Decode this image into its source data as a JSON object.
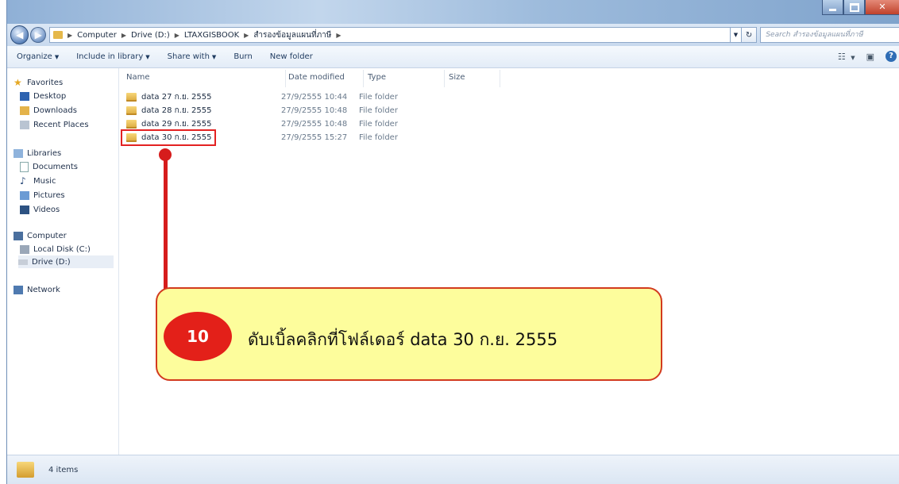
{
  "address": {
    "crumbs": [
      "Computer",
      "Drive (D:)",
      "LTAXGISBOOK",
      "สำรองข้อมูลแผนที่ภาษี"
    ],
    "search_placeholder": "Search สำรองข้อมูลแผนที่ภาษี"
  },
  "toolbar": {
    "organize": "Organize",
    "include": "Include in library",
    "share": "Share with",
    "burn": "Burn",
    "new_folder": "New folder"
  },
  "nav": {
    "favorites": "Favorites",
    "desktop": "Desktop",
    "downloads": "Downloads",
    "recent": "Recent Places",
    "libraries": "Libraries",
    "documents": "Documents",
    "music": "Music",
    "pictures": "Pictures",
    "videos": "Videos",
    "computer": "Computer",
    "local_disk": "Local Disk (C:)",
    "drive_d": "Drive (D:)",
    "network": "Network"
  },
  "columns": {
    "name": "Name",
    "date": "Date modified",
    "type": "Type",
    "size": "Size"
  },
  "files": [
    {
      "name": "data 27 ก.ย. 2555",
      "date": "27/9/2555 10:44",
      "type": "File folder"
    },
    {
      "name": "data 28 ก.ย. 2555",
      "date": "27/9/2555 10:48",
      "type": "File folder"
    },
    {
      "name": "data 29 ก.ย. 2555",
      "date": "27/9/2555 10:48",
      "type": "File folder"
    },
    {
      "name": "data 30 ก.ย. 2555",
      "date": "27/9/2555 15:27",
      "type": "File folder"
    }
  ],
  "callout": {
    "step": "10",
    "text": "ดับเบิ้ลคลิกที่โฟล์เดอร์ data 30 ก.ย. 2555"
  },
  "status": {
    "count": "4 items"
  }
}
